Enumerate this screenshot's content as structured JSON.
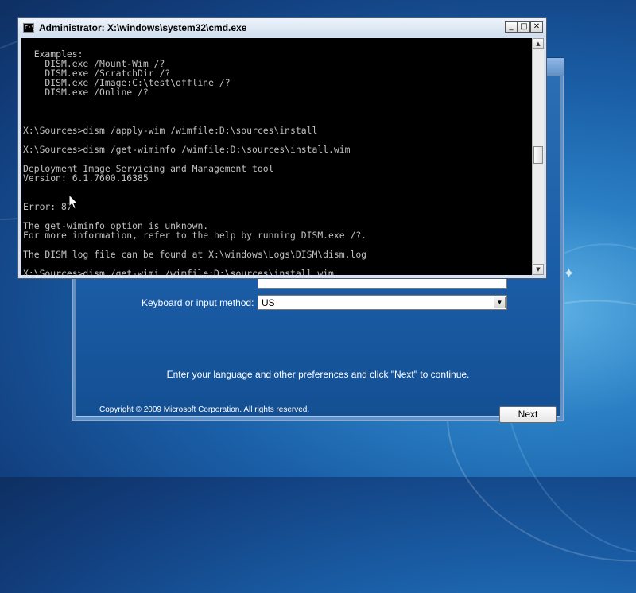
{
  "cmd_window": {
    "title": "Administrator: X:\\windows\\system32\\cmd.exe",
    "icon_text": "C:\\",
    "controls": {
      "minimize": "_",
      "maximize": "□",
      "close": "✕"
    },
    "console_lines": [
      "",
      "  Examples:",
      "    DISM.exe /Mount-Wim /?",
      "    DISM.exe /ScratchDir /?",
      "    DISM.exe /Image:C:\\test\\offline /?",
      "    DISM.exe /Online /?",
      "",
      "",
      "",
      "X:\\Sources>dism /apply-wim /wimfile:D:\\sources\\install",
      "",
      "X:\\Sources>dism /get-wiminfo /wimfile:D:\\sources\\install.wim",
      "",
      "Deployment Image Servicing and Management tool",
      "Version: 6.1.7600.16385",
      "",
      "",
      "Error: 87",
      "",
      "The get-wiminfo option is unknown.",
      "For more information, refer to the help by running DISM.exe /?.",
      "",
      "The DISM log file can be found at X:\\windows\\Logs\\DISM\\dism.log",
      "",
      "X:\\Sources>dism /get-wimi_/wimfile:D:\\sources\\install.wim"
    ],
    "scrollbar": {
      "up": "▲",
      "down": "▼"
    }
  },
  "setup_window": {
    "keyboard_label": "Keyboard or input method:",
    "keyboard_value": "US",
    "dropdown_glyph": "▼",
    "instruction": "Enter your language and other preferences and click \"Next\" to continue.",
    "copyright": "Copyright © 2009 Microsoft Corporation. All rights reserved.",
    "next_label": "Next"
  },
  "desktop": {
    "sparkle_glyph": "✦"
  }
}
